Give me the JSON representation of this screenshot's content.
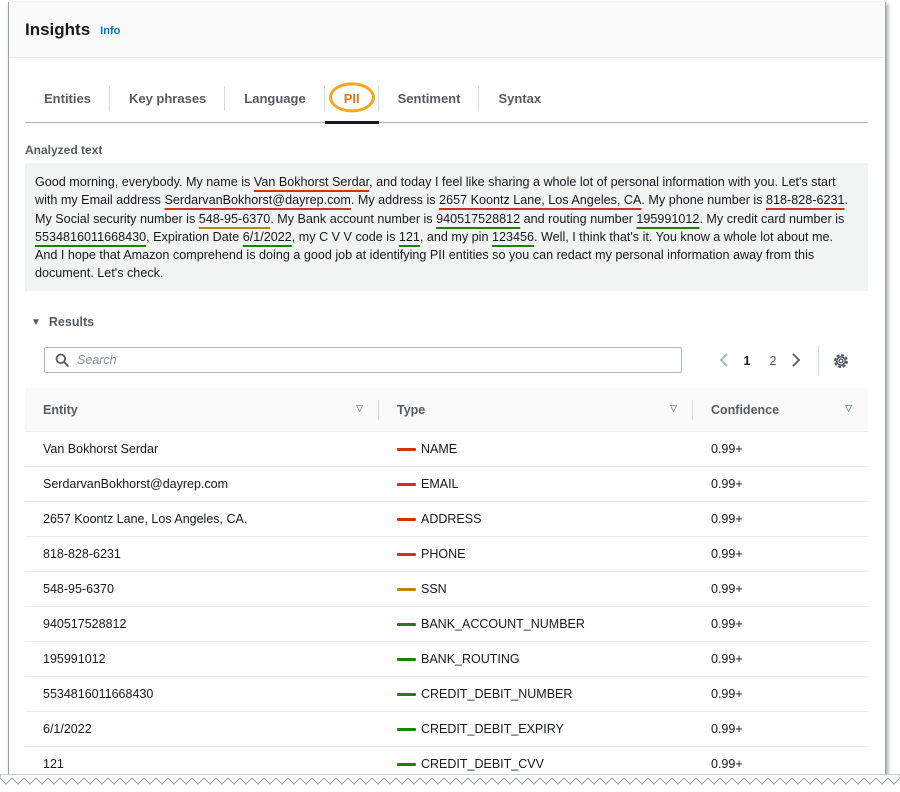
{
  "header": {
    "title": "Insights",
    "info": "Info"
  },
  "tabs": [
    {
      "label": "Entities"
    },
    {
      "label": "Key phrases"
    },
    {
      "label": "Language"
    },
    {
      "label": "PII"
    },
    {
      "label": "Sentiment"
    },
    {
      "label": "Syntax"
    }
  ],
  "active_tab": "PII",
  "analyzed": {
    "label": "Analyzed text",
    "segments": [
      {
        "text": "Good morning, everybody. My name is ",
        "u": null
      },
      {
        "text": "Van Bokhorst Serdar",
        "u": "red"
      },
      {
        "text": ", and today I feel like sharing a whole lot of personal information with you. Let's start with my Email address ",
        "u": null
      },
      {
        "text": "SerdarvanBokhorst@dayrep.com",
        "u": "red"
      },
      {
        "text": ". My address is ",
        "u": null
      },
      {
        "text": "2657 Koontz Lane, Los Angeles, CA",
        "u": "red"
      },
      {
        "text": ". My phone number is ",
        "u": null
      },
      {
        "text": "818-828-6231",
        "u": "red"
      },
      {
        "text": ". My Social security number is ",
        "u": null
      },
      {
        "text": "548-95-6370",
        "u": "gold"
      },
      {
        "text": ". My Bank account number is ",
        "u": null
      },
      {
        "text": "940517528812",
        "u": "green"
      },
      {
        "text": " and routing number ",
        "u": null
      },
      {
        "text": "195991012",
        "u": "green"
      },
      {
        "text": ". My credit card number is ",
        "u": null
      },
      {
        "text": "5534816011668430",
        "u": "green"
      },
      {
        "text": ", Expiration Date ",
        "u": null
      },
      {
        "text": "6/1/2022",
        "u": "green"
      },
      {
        "text": ", my C V V code is ",
        "u": null
      },
      {
        "text": "121",
        "u": "green"
      },
      {
        "text": ", and my pin ",
        "u": null
      },
      {
        "text": "123456",
        "u": "green"
      },
      {
        "text": ". Well, I think that's it. You know a whole lot about me. And I hope that Amazon comprehend is doing a good job at identifying PII entities so you can redact my personal information away from this document. Let's check.",
        "u": null
      }
    ]
  },
  "results": {
    "label": "Results",
    "search_placeholder": "Search",
    "pages": [
      "1",
      "2"
    ],
    "current_page": "1",
    "columns": [
      "Entity",
      "Type",
      "Confidence"
    ],
    "rows": [
      {
        "entity": "Van Bokhorst Serdar",
        "type": "NAME",
        "color": "#d13212",
        "confidence": "0.99+"
      },
      {
        "entity": "SerdarvanBokhorst@dayrep.com",
        "type": "EMAIL",
        "color": "#d13212",
        "confidence": "0.99+"
      },
      {
        "entity": "2657 Koontz Lane, Los Angeles, CA.",
        "type": "ADDRESS",
        "color": "#d13212",
        "confidence": "0.99+"
      },
      {
        "entity": "818-828-6231",
        "type": "PHONE",
        "color": "#d13212",
        "confidence": "0.99+"
      },
      {
        "entity": "548-95-6370",
        "type": "SSN",
        "color": "#b8860b",
        "confidence": "0.99+"
      },
      {
        "entity": "940517528812",
        "type": "BANK_ACCOUNT_NUMBER",
        "color": "#1d8102",
        "confidence": "0.99+"
      },
      {
        "entity": "195991012",
        "type": "BANK_ROUTING",
        "color": "#1d8102",
        "confidence": "0.99+"
      },
      {
        "entity": "5534816011668430",
        "type": "CREDIT_DEBIT_NUMBER",
        "color": "#1d8102",
        "confidence": "0.99+"
      },
      {
        "entity": "6/1/2022",
        "type": "CREDIT_DEBIT_EXPIRY",
        "color": "#1d8102",
        "confidence": "0.99+"
      },
      {
        "entity": "121",
        "type": "CREDIT_DEBIT_CVV",
        "color": "#1d8102",
        "confidence": "0.99+"
      }
    ]
  },
  "colors": {
    "red": "#d13212",
    "gold": "#b8860b",
    "green": "#1d8102",
    "accent": "#ec7211",
    "link": "#0073bb"
  },
  "icons": {
    "search": "search-icon",
    "gear": "gear-icon",
    "prev": "chevron-left-icon",
    "next": "chevron-right-icon",
    "caret": "caret-down-icon",
    "sort": "sort-icon"
  }
}
